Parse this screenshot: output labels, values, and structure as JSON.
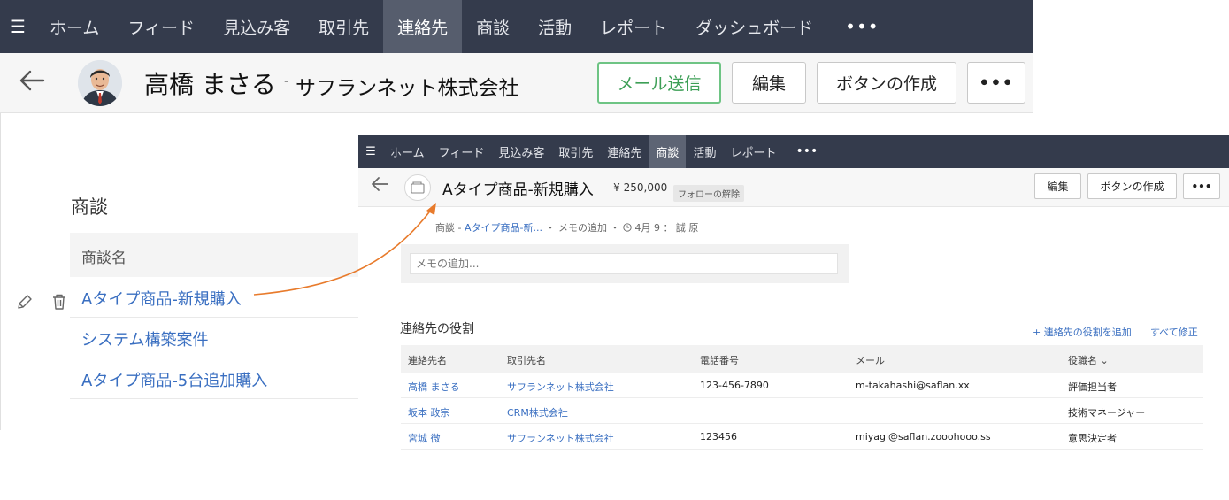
{
  "contact_window": {
    "nav": {
      "items": [
        "ホーム",
        "フィード",
        "見込み客",
        "取引先",
        "連絡先",
        "商談",
        "活動",
        "レポート",
        "ダッシュボード"
      ],
      "active_index": 4,
      "more": "•••"
    },
    "header": {
      "name": "高橋 まさる",
      "separator": "-",
      "company": "サフランネット株式会社",
      "buttons": {
        "send_mail": "メール送信",
        "edit": "編集",
        "create_button": "ボタンの作成",
        "more": "•••"
      }
    },
    "deals": {
      "heading": "商談",
      "column_header": "商談名",
      "rows": [
        "Aタイプ商品-新規購入",
        "システム構築案件",
        "Aタイプ商品-5台追加購入"
      ]
    }
  },
  "deal_window": {
    "nav": {
      "items": [
        "ホーム",
        "フィード",
        "見込み客",
        "取引先",
        "連絡先",
        "商談",
        "活動",
        "レポート"
      ],
      "active_index": 5,
      "more": "•••"
    },
    "header": {
      "title": "Aタイプ商品-新規購入",
      "amount": "- ¥ 250,000",
      "follow_badge": "フォローの解除",
      "buttons": {
        "edit": "編集",
        "create_button": "ボタンの作成",
        "more": "•••"
      }
    },
    "breadcrumb": {
      "module": "商談 - ",
      "record": "Aタイプ商品-新...",
      "sep1": " ・ ",
      "memo_add": "メモの追加",
      "sep2": " ・ ",
      "date": " 4月 9 ： 誠 原"
    },
    "memo": {
      "placeholder": "メモの追加..."
    },
    "contact_roles": {
      "title": "連絡先の役割",
      "add_link": "+ 連絡先の役割を追加",
      "edit_all_link": "すべて修正",
      "columns": [
        "連絡先名",
        "取引先名",
        "電話番号",
        "メール",
        "役職名 ⌄"
      ],
      "rows": [
        {
          "contact": "高橋 まさる",
          "account": "サフランネット株式会社",
          "phone": "123-456-7890",
          "email": "m-takahashi@saflan.xx",
          "role": "評価担当者"
        },
        {
          "contact": "坂本 政宗",
          "account": "CRM株式会社",
          "phone": "",
          "email": "",
          "role": "技術マネージャー"
        },
        {
          "contact": "宮城 微",
          "account": "サフランネット株式会社",
          "phone": "123456",
          "email": "miyagi@saflan.zooohooo.ss",
          "role": "意思決定者"
        }
      ]
    }
  },
  "colors": {
    "nav_bg": "#343b4c",
    "nav_active": "#565d6d",
    "link_blue": "#3a6fc1",
    "mail_button_green": "#6ec484",
    "arrow_orange": "#e87b2c"
  }
}
